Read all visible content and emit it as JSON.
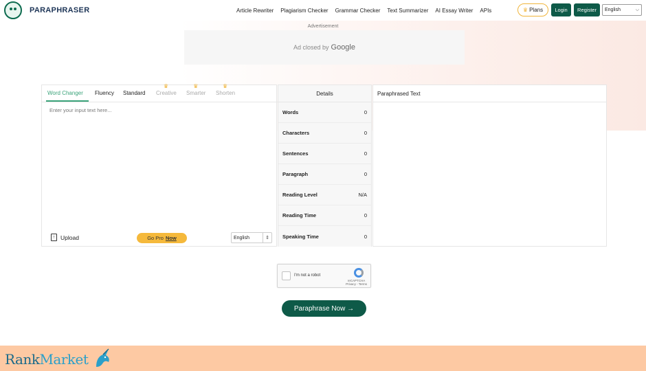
{
  "brand": {
    "name": "PARAPHRASER"
  },
  "nav": {
    "links": [
      "Article Rewriter",
      "Plagiarism Checker",
      "Grammar Checker",
      "Text Summarizer",
      "AI Essay Writer",
      "APIs"
    ],
    "plans_label": "Plans",
    "login_label": "Login",
    "register_label": "Register",
    "language": "English"
  },
  "ad": {
    "label": "Advertisement",
    "closed_text": "Ad closed by",
    "closed_brand": "Google"
  },
  "editor": {
    "tabs": [
      {
        "label": "Word Changer",
        "state": "active"
      },
      {
        "label": "Fluency",
        "state": "normal"
      },
      {
        "label": "Standard",
        "state": "normal"
      },
      {
        "label": "Creative",
        "state": "locked"
      },
      {
        "label": "Smarter",
        "state": "locked"
      },
      {
        "label": "Shorten",
        "state": "locked"
      }
    ],
    "placeholder": "Enter your input text here...",
    "upload_label": "Upload",
    "gopro_label": "Go Pro",
    "gopro_now": "Now",
    "language": "English"
  },
  "details": {
    "title": "Details",
    "rows": [
      {
        "label": "Words",
        "value": "0"
      },
      {
        "label": "Characters",
        "value": "0"
      },
      {
        "label": "Sentences",
        "value": "0"
      },
      {
        "label": "Paragraph",
        "value": "0"
      },
      {
        "label": "Reading Level",
        "value": "N/A"
      },
      {
        "label": "Reading Time",
        "value": "0"
      },
      {
        "label": "Speaking Time",
        "value": "0"
      }
    ]
  },
  "output": {
    "title": "Paraphrased Text"
  },
  "captcha": {
    "label": "I'm not a robot",
    "brand": "reCAPTCHA",
    "links": "Privacy - Terms"
  },
  "cta": {
    "label": "Paraphrase Now →"
  },
  "footer": {
    "brand_part1": "Rank",
    "brand_part2": "Market"
  },
  "colors": {
    "primary": "#0e5a48",
    "accent_green": "#3aa37a",
    "gold": "#f5b93c",
    "footer_bg": "#fdc9a3"
  }
}
